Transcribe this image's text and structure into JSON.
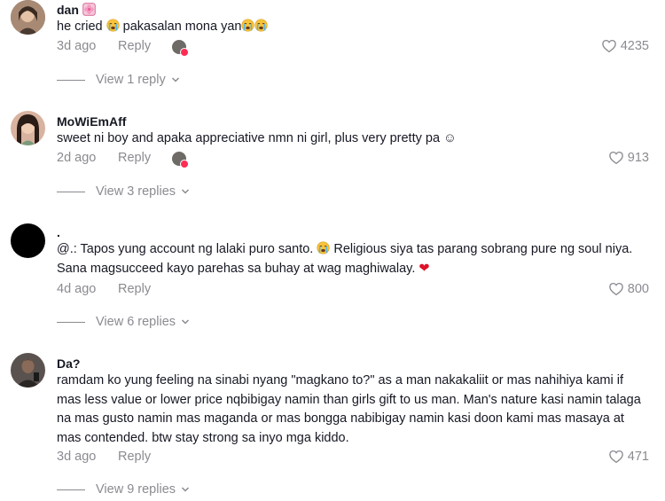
{
  "comments": [
    {
      "author": "dan",
      "text_parts": [
        "he cried ",
        " pakasalan mona yan"
      ],
      "date": "3d ago",
      "reply_label": "Reply",
      "likes": "4235",
      "view_replies": "View 1 reply",
      "avatar_color": "#8b6a57"
    },
    {
      "author": "MoWiEmAff",
      "text_parts": [
        "sweet ni boy and apaka appreciative nmn ni girl, plus very pretty pa ☺"
      ],
      "date": "2d ago",
      "reply_label": "Reply",
      "likes": "913",
      "view_replies": "View 3 replies",
      "avatar_color": "#c99a88"
    },
    {
      "author": ".",
      "text_line1_a": "@.: Tapos yung account ng lalaki puro santo. ",
      "text_line1_b": " Religious siya tas parang sobrang pure ng soul niya.",
      "text_line2": "Sana magsucceed kayo parehas sa buhay at wag maghiwalay. ",
      "heart_emoji": "❤",
      "date": "4d ago",
      "reply_label": "Reply",
      "likes": "800",
      "view_replies": "View 6 replies",
      "avatar_color": "#000000"
    },
    {
      "author": "Da?",
      "text": "ramdam ko yung feeling na sinabi nyang \"magkano to?\" as a man nakakaliit or mas nahihiya kami if mas less value or lower price nqbibigay namin than girls gift to us man. Man's nature kasi namin talaga na mas gusto namin mas maganda or mas bongga nabibigay namin kasi doon kami mas masaya at mas contended. btw stay strong sa inyo mga kiddo.",
      "date": "3d ago",
      "reply_label": "Reply",
      "likes": "471",
      "view_replies": "View 9 replies",
      "avatar_color": "#3b3532"
    }
  ],
  "icons": {
    "like": "heart-outline-icon",
    "chevron": "chevron-down-icon",
    "cry_emoji": "crying-face-emoji",
    "flower_emoji": "cherry-blossom-emoji"
  },
  "colors": {
    "text": "#161823",
    "muted": "#8a8b91",
    "accent_red": "#fe2c55"
  }
}
